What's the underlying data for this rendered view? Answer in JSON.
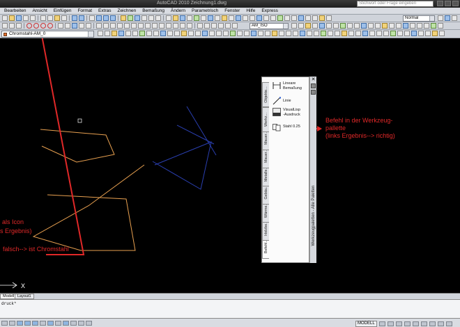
{
  "window": {
    "title": "AutoCAD 2010   Zeichnung1.dwg",
    "search_placeholder": "Stichwort oder Frage eingeben"
  },
  "menu": [
    "Bearbeiten",
    "Ansicht",
    "Einfügen",
    "Format",
    "Extras",
    "Zeichnen",
    "Bemaßung",
    "Ändern",
    "Parametrisch",
    "Fenster",
    "Hilfe",
    "Express"
  ],
  "toolbar": {
    "layer_combo": "Chromstahl-AM_0",
    "dimstyle_combo": "AM_ISO",
    "textstyle_combo": "Normal"
  },
  "palette": {
    "tabs": [
      "Befehl...",
      "Holzbe...",
      "Wärme...",
      "Gebäu...",
      "Metalle...",
      "Mauer...",
      "Mauer...",
      "Werkz...",
      "Objekte..."
    ],
    "side_title": "Werkzeugpaletten - Alle Paletten",
    "tools": [
      {
        "label": "Lineare\nBemaßung",
        "icon": "linear-dimension-icon"
      },
      {
        "label": "Linie",
        "icon": "line-icon"
      },
      {
        "label": "VisualLisp\n-Ausdruck",
        "icon": "lisp-icon"
      },
      {
        "label": "Stahl 0.25",
        "icon": "layer-steel-icon"
      }
    ]
  },
  "annotations": {
    "right_lines": [
      "Befehl in der Werkzeug-",
      "pallette",
      "(links Ergebnis--> richtig)"
    ],
    "left_line1": "als Icon",
    "left_line2": "s Ergebnis)",
    "left_line3": "falsch--> ist Chromstahl"
  },
  "layout_tabs": [
    "Modell",
    "Layout1"
  ],
  "command_line": "druck*",
  "status": {
    "model": "MODELL"
  },
  "colors": {
    "annotation_red": "#e02828",
    "orange_lines": "#e8a050",
    "blue_lines": "#2a3fb0"
  }
}
